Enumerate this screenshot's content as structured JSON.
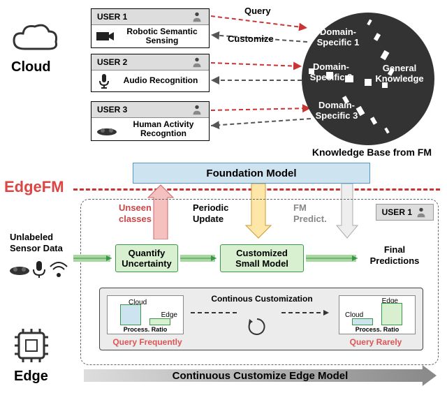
{
  "sections": {
    "cloud": "Cloud",
    "edge": "Edge",
    "edgefm": "EdgeFM"
  },
  "users": [
    {
      "id": "USER 1",
      "task": "Robotic Semantic Sensing",
      "icon": "camera"
    },
    {
      "id": "USER 2",
      "task": "Audio Recognition",
      "icon": "mic"
    },
    {
      "id": "USER 3",
      "task": "Human Activity Recogntion",
      "icon": "camera-3d"
    }
  ],
  "arrows": {
    "query": "Query",
    "customize": "Customize"
  },
  "kb": {
    "d1": "Domain-Specific 1",
    "d2": "Domain-Specific 2",
    "d3": "Domain-Specific 3",
    "gk": "General Knowledge",
    "caption": "Knowledge Base from FM"
  },
  "fm_bar": "Foundation   Model",
  "edge_user": "USER 1",
  "labels": {
    "unlabeled": "Unlabeled Sensor Data",
    "unseen": "Unseen classes",
    "periodic": "Periodic Update",
    "fmpred": "FM Predict.",
    "quantify": "Quantify Uncertainty",
    "custom": "Customized Small Model",
    "final": "Final Predictions"
  },
  "inset": {
    "title": "Continous Customization",
    "qf": "Query Frequently",
    "qr": "Query Rarely",
    "chart": {
      "axis": "Process. Ratio",
      "series": [
        "Cloud",
        "Edge"
      ]
    }
  },
  "gradient": "Continuous Customize Edge Model",
  "chart_data": {
    "type": "bar",
    "note": "Conceptual mini bar charts showing cloud vs edge processing ratio shift over time",
    "charts": [
      {
        "title": "Query Frequently",
        "categories": [
          "Cloud",
          "Edge"
        ],
        "values": [
          0.8,
          0.2
        ],
        "ylabel": "Process. Ratio"
      },
      {
        "title": "Query Rarely",
        "categories": [
          "Cloud",
          "Edge"
        ],
        "values": [
          0.2,
          0.8
        ],
        "ylabel": "Process. Ratio"
      }
    ]
  }
}
